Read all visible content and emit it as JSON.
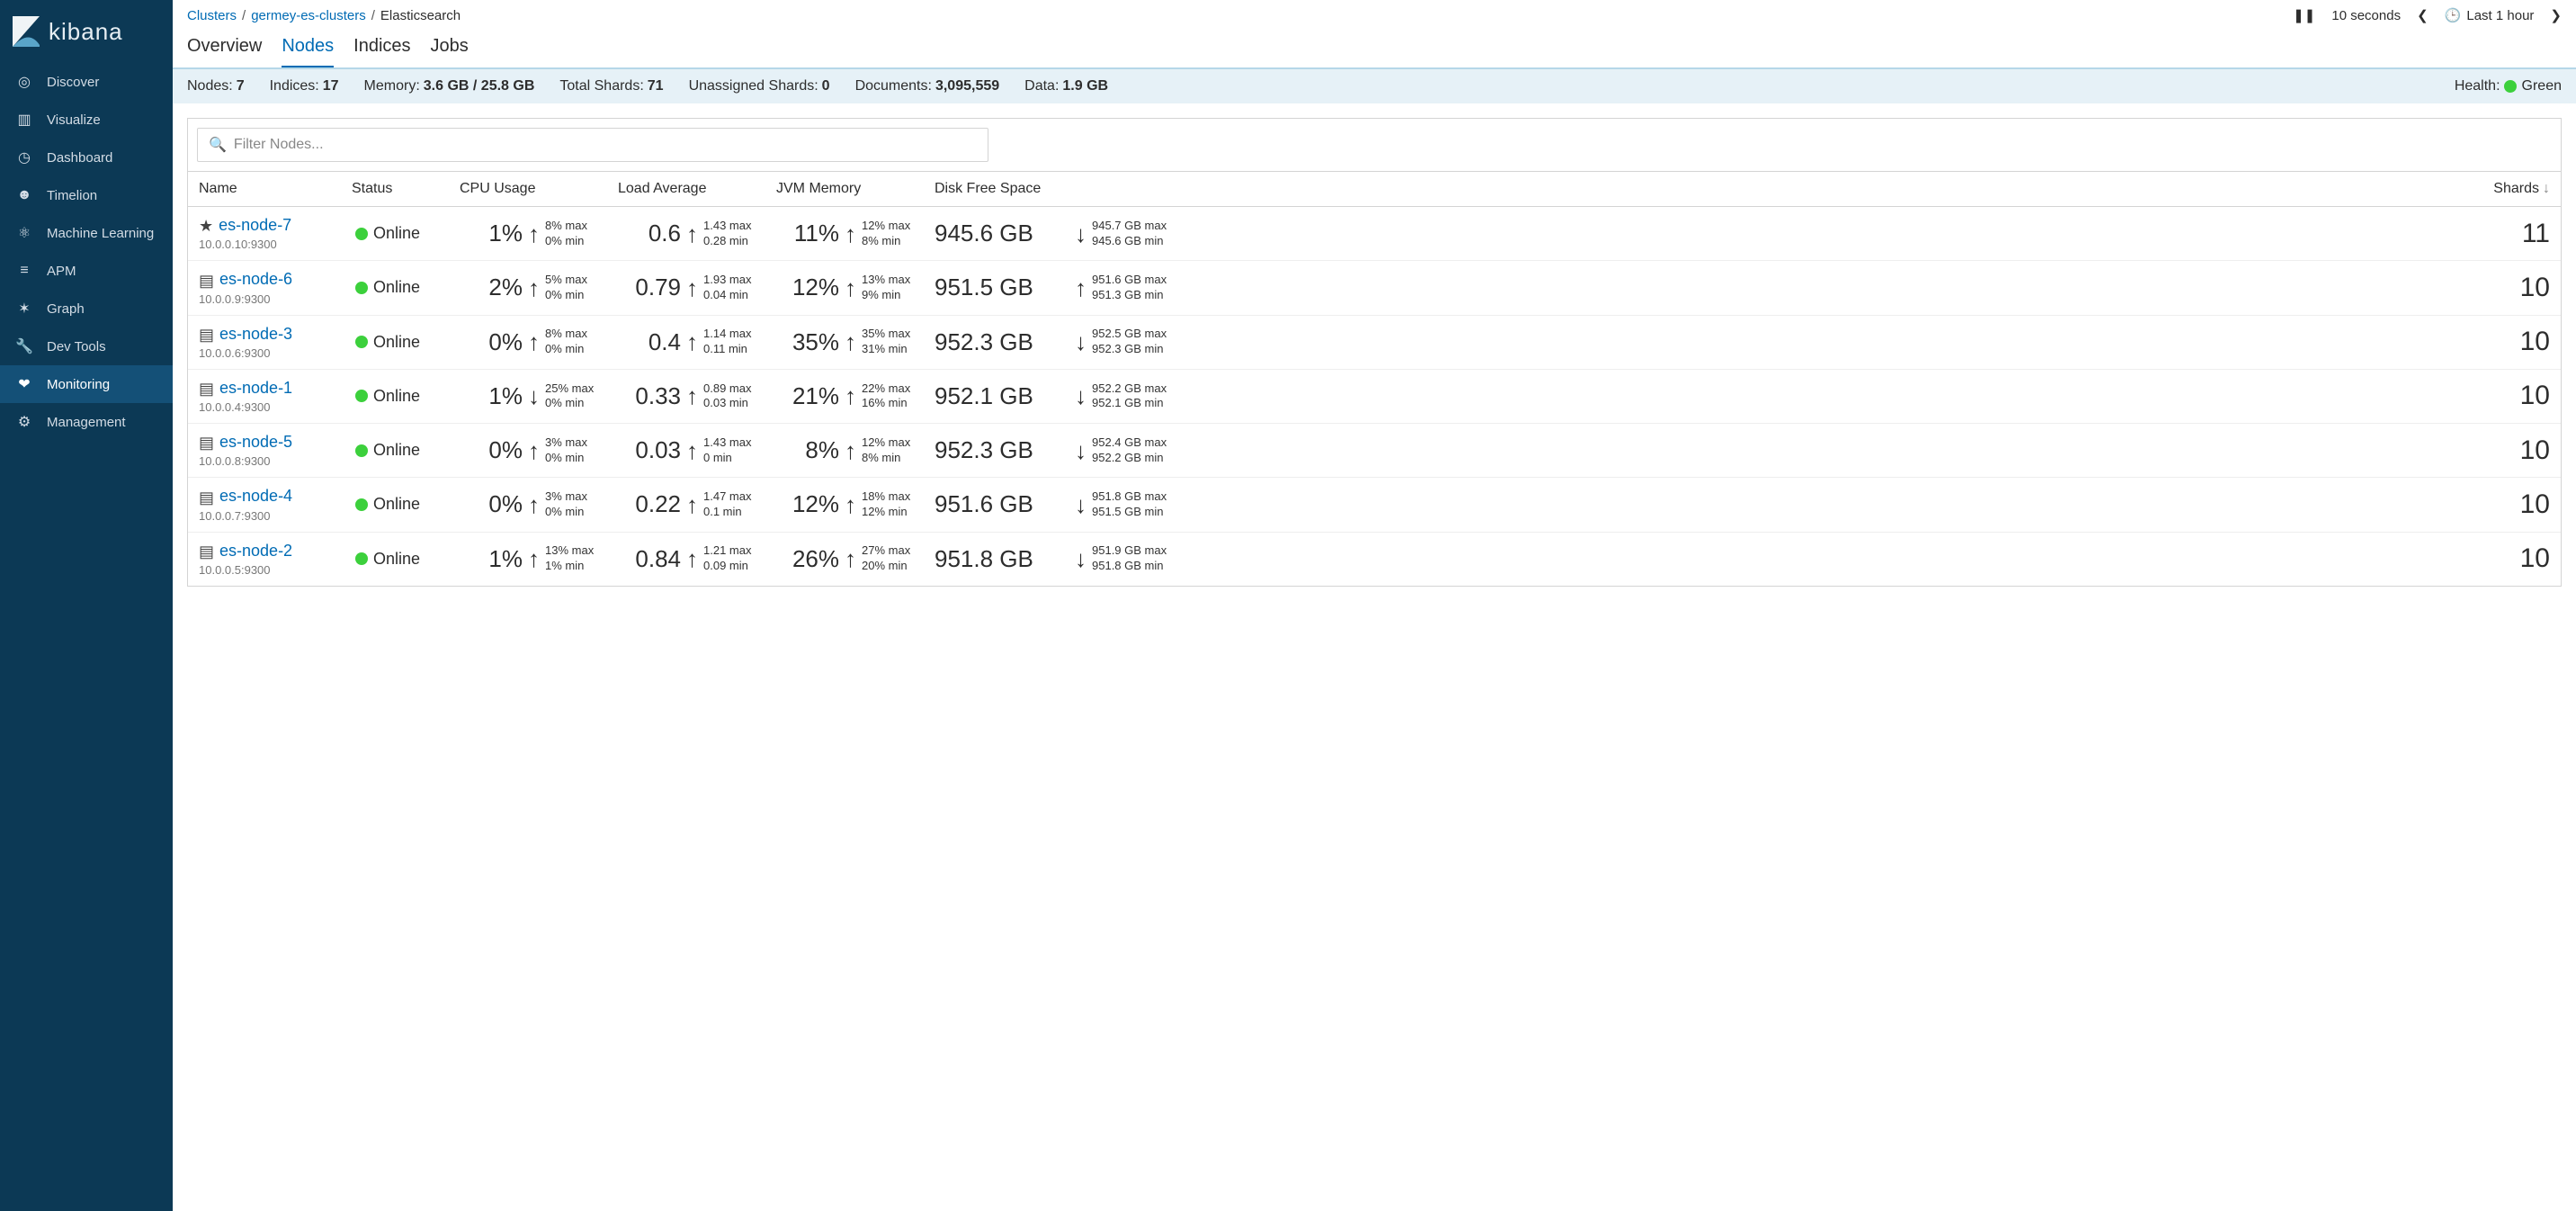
{
  "brand": "kibana",
  "sidebar": {
    "items": [
      {
        "label": "Discover",
        "icon": "◎"
      },
      {
        "label": "Visualize",
        "icon": "▥"
      },
      {
        "label": "Dashboard",
        "icon": "◷"
      },
      {
        "label": "Timelion",
        "icon": "☻"
      },
      {
        "label": "Machine Learning",
        "icon": "⚛"
      },
      {
        "label": "APM",
        "icon": "≡"
      },
      {
        "label": "Graph",
        "icon": "✶"
      },
      {
        "label": "Dev Tools",
        "icon": "🔧"
      },
      {
        "label": "Monitoring",
        "icon": "❤"
      },
      {
        "label": "Management",
        "icon": "⚙"
      }
    ],
    "activeIndex": 8
  },
  "breadcrumb": {
    "items": [
      {
        "label": "Clusters",
        "link": true
      },
      {
        "label": "germey-es-clusters",
        "link": true
      },
      {
        "label": "Elasticsearch",
        "link": false
      }
    ],
    "sep": "/"
  },
  "toolbar": {
    "interval": "10 seconds",
    "range": "Last 1 hour"
  },
  "tabs": {
    "items": [
      "Overview",
      "Nodes",
      "Indices",
      "Jobs"
    ],
    "activeIndex": 1
  },
  "stats": {
    "nodes": {
      "k": "Nodes:",
      "v": "7"
    },
    "indices": {
      "k": "Indices:",
      "v": "17"
    },
    "memory": {
      "k": "Memory:",
      "v": "3.6 GB / 25.8 GB"
    },
    "totalShards": {
      "k": "Total Shards:",
      "v": "71"
    },
    "unassigned": {
      "k": "Unassigned Shards:",
      "v": "0"
    },
    "documents": {
      "k": "Documents:",
      "v": "3,095,559"
    },
    "data": {
      "k": "Data:",
      "v": "1.9 GB"
    },
    "health": {
      "k": "Health:",
      "v": "Green"
    }
  },
  "filter": {
    "placeholder": "Filter Nodes..."
  },
  "columns": {
    "name": "Name",
    "status": "Status",
    "cpu": "CPU Usage",
    "load": "Load Average",
    "jvm": "JVM Memory",
    "disk": "Disk Free Space",
    "shards": "Shards"
  },
  "sortIndicator": "↓",
  "rows": [
    {
      "star": true,
      "name": "es-node-7",
      "addr": "10.0.0.10:9300",
      "status": "Online",
      "cpu": {
        "v": "1%",
        "dir": "↑",
        "max": "8% max",
        "min": "0% min"
      },
      "load": {
        "v": "0.6",
        "dir": "↑",
        "max": "1.43 max",
        "min": "0.28 min"
      },
      "jvm": {
        "v": "11%",
        "dir": "↑",
        "max": "12% max",
        "min": "8% min"
      },
      "disk": {
        "v": "945.6 GB",
        "dir": "↓",
        "max": "945.7 GB max",
        "min": "945.6 GB min"
      },
      "shards": "11"
    },
    {
      "star": false,
      "name": "es-node-6",
      "addr": "10.0.0.9:9300",
      "status": "Online",
      "cpu": {
        "v": "2%",
        "dir": "↑",
        "max": "5% max",
        "min": "0% min"
      },
      "load": {
        "v": "0.79",
        "dir": "↑",
        "max": "1.93 max",
        "min": "0.04 min"
      },
      "jvm": {
        "v": "12%",
        "dir": "↑",
        "max": "13% max",
        "min": "9% min"
      },
      "disk": {
        "v": "951.5 GB",
        "dir": "↑",
        "max": "951.6 GB max",
        "min": "951.3 GB min"
      },
      "shards": "10"
    },
    {
      "star": false,
      "name": "es-node-3",
      "addr": "10.0.0.6:9300",
      "status": "Online",
      "cpu": {
        "v": "0%",
        "dir": "↑",
        "max": "8% max",
        "min": "0% min"
      },
      "load": {
        "v": "0.4",
        "dir": "↑",
        "max": "1.14 max",
        "min": "0.11 min"
      },
      "jvm": {
        "v": "35%",
        "dir": "↑",
        "max": "35% max",
        "min": "31% min"
      },
      "disk": {
        "v": "952.3 GB",
        "dir": "↓",
        "max": "952.5 GB max",
        "min": "952.3 GB min"
      },
      "shards": "10"
    },
    {
      "star": false,
      "name": "es-node-1",
      "addr": "10.0.0.4:9300",
      "status": "Online",
      "cpu": {
        "v": "1%",
        "dir": "↓",
        "max": "25% max",
        "min": "0% min"
      },
      "load": {
        "v": "0.33",
        "dir": "↑",
        "max": "0.89 max",
        "min": "0.03 min"
      },
      "jvm": {
        "v": "21%",
        "dir": "↑",
        "max": "22% max",
        "min": "16% min"
      },
      "disk": {
        "v": "952.1 GB",
        "dir": "↓",
        "max": "952.2 GB max",
        "min": "952.1 GB min"
      },
      "shards": "10"
    },
    {
      "star": false,
      "name": "es-node-5",
      "addr": "10.0.0.8:9300",
      "status": "Online",
      "cpu": {
        "v": "0%",
        "dir": "↑",
        "max": "3% max",
        "min": "0% min"
      },
      "load": {
        "v": "0.03",
        "dir": "↑",
        "max": "1.43 max",
        "min": "0 min"
      },
      "jvm": {
        "v": "8%",
        "dir": "↑",
        "max": "12% max",
        "min": "8% min"
      },
      "disk": {
        "v": "952.3 GB",
        "dir": "↓",
        "max": "952.4 GB max",
        "min": "952.2 GB min"
      },
      "shards": "10"
    },
    {
      "star": false,
      "name": "es-node-4",
      "addr": "10.0.0.7:9300",
      "status": "Online",
      "cpu": {
        "v": "0%",
        "dir": "↑",
        "max": "3% max",
        "min": "0% min"
      },
      "load": {
        "v": "0.22",
        "dir": "↑",
        "max": "1.47 max",
        "min": "0.1 min"
      },
      "jvm": {
        "v": "12%",
        "dir": "↑",
        "max": "18% max",
        "min": "12% min"
      },
      "disk": {
        "v": "951.6 GB",
        "dir": "↓",
        "max": "951.8 GB max",
        "min": "951.5 GB min"
      },
      "shards": "10"
    },
    {
      "star": false,
      "name": "es-node-2",
      "addr": "10.0.0.5:9300",
      "status": "Online",
      "cpu": {
        "v": "1%",
        "dir": "↑",
        "max": "13% max",
        "min": "1% min"
      },
      "load": {
        "v": "0.84",
        "dir": "↑",
        "max": "1.21 max",
        "min": "0.09 min"
      },
      "jvm": {
        "v": "26%",
        "dir": "↑",
        "max": "27% max",
        "min": "20% min"
      },
      "disk": {
        "v": "951.8 GB",
        "dir": "↓",
        "max": "951.9 GB max",
        "min": "951.8 GB min"
      },
      "shards": "10"
    }
  ]
}
